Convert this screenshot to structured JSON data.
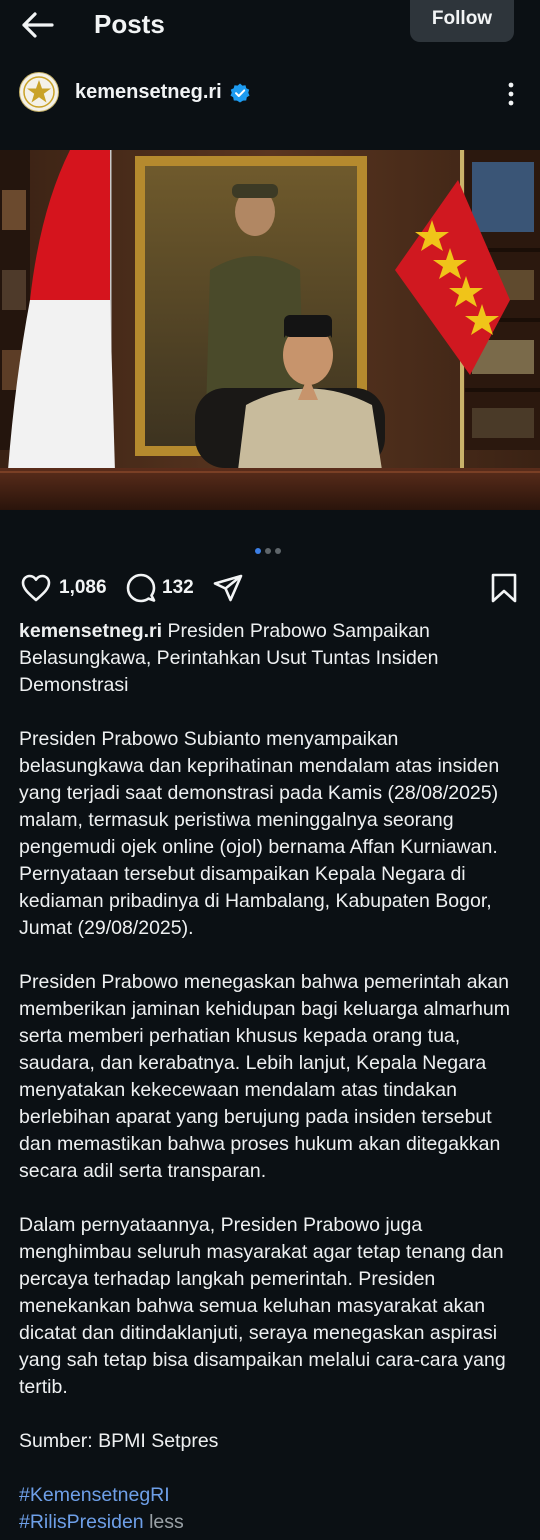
{
  "topbar": {
    "title": "Posts",
    "follow_label": "Follow"
  },
  "post": {
    "username": "kemensetneg.ri",
    "likes": "1,086",
    "comments": "132",
    "carousel": {
      "count": 3,
      "active_index": 0
    }
  },
  "caption": {
    "username": "kemensetneg.ri",
    "headline": "Presiden Prabowo Sampaikan Belasungkawa, Perintahkan Usut Tuntas Insiden Demonstrasi",
    "p1": "Presiden Prabowo Subianto menyampaikan belasungkawa dan keprihatinan mendalam atas insiden yang terjadi saat demonstrasi pada Kamis (28/08/2025) malam, termasuk peristiwa meninggalnya seorang pengemudi ojek online (ojol) bernama Affan Kurniawan. Pernyataan tersebut disampaikan Kepala Negara di kediaman pribadinya di Hambalang, Kabupaten Bogor, Jumat (29/08/2025).",
    "p2": "Presiden Prabowo menegaskan bahwa pemerintah akan memberikan jaminan kehidupan bagi keluarga almarhum serta memberi perhatian khusus kepada orang tua, saudara, dan kerabatnya. Lebih lanjut, Kepala Negara menyatakan kekecewaan mendalam atas tindakan berlebihan aparat yang berujung pada insiden tersebut dan memastikan bahwa proses hukum akan ditegakkan secara adil serta transparan.",
    "p3": "Dalam pernyataannya, Presiden Prabowo juga menghimbau seluruh masyarakat agar tetap tenang dan percaya terhadap langkah pemerintah. Presiden menekankan bahwa semua keluhan masyarakat akan dicatat dan ditindaklanjuti, seraya menegaskan aspirasi yang sah tetap bisa disampaikan melalui cara-cara yang tertib.",
    "source": "Sumber: BPMI Setpres",
    "hashtag1": "#KemensetnegRI",
    "hashtag2": "#RilisPresiden",
    "less": "less"
  },
  "colors": {
    "background": "#0b1014",
    "link": "#6e9fe8",
    "verified": "#1d9bf0",
    "active_dot": "#3c7fe6"
  },
  "icons": [
    "back-arrow-icon",
    "verified-badge-icon",
    "more-vertical-icon",
    "heart-icon",
    "comment-icon",
    "share-icon",
    "bookmark-icon"
  ]
}
